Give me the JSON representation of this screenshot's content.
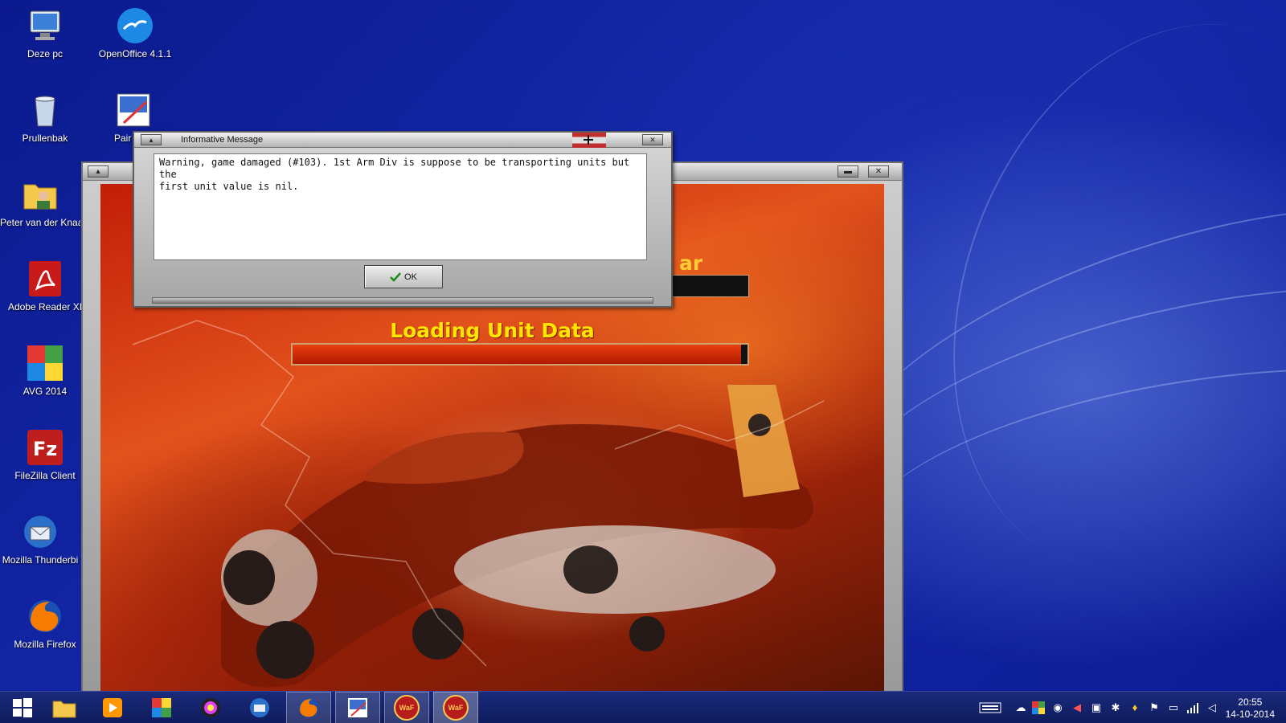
{
  "desktop": {
    "icons": [
      {
        "label": "Deze pc"
      },
      {
        "label": "OpenOffice 4.1.1"
      },
      {
        "label": "Prullenbak"
      },
      {
        "label": "Pair"
      },
      {
        "label": "Peter van der Knaa"
      },
      {
        "label": "Adobe Reader XI"
      },
      {
        "label": "AVG 2014"
      },
      {
        "label": "FileZilla Client"
      },
      {
        "label": "Mozilla Thunderbi"
      },
      {
        "label": "Mozilla Firefox"
      }
    ]
  },
  "game": {
    "partial_title": "ar",
    "loading_title": "Loading Unit Data",
    "progress_fraction": 0.985
  },
  "dialog": {
    "title": "Informative Message",
    "message_line1": "Warning, game damaged (#103).  1st Arm Div is suppose to be transporting units but the",
    "message_line2": "first unit value is nil.",
    "ok_label": "OK"
  },
  "taskbar": {
    "apps": [
      "windows-start",
      "file-explorer",
      "media-player",
      "paint-app",
      "picasa",
      "thunderbird",
      "firefox",
      "paint",
      "game-1",
      "game-2"
    ],
    "game_button_text": "WaF"
  },
  "clock": {
    "time": "20:55",
    "date": "14-10-2014"
  },
  "colors": {
    "accent_loading_text": "#ffe600",
    "desktop_blue": "#1327a8"
  }
}
